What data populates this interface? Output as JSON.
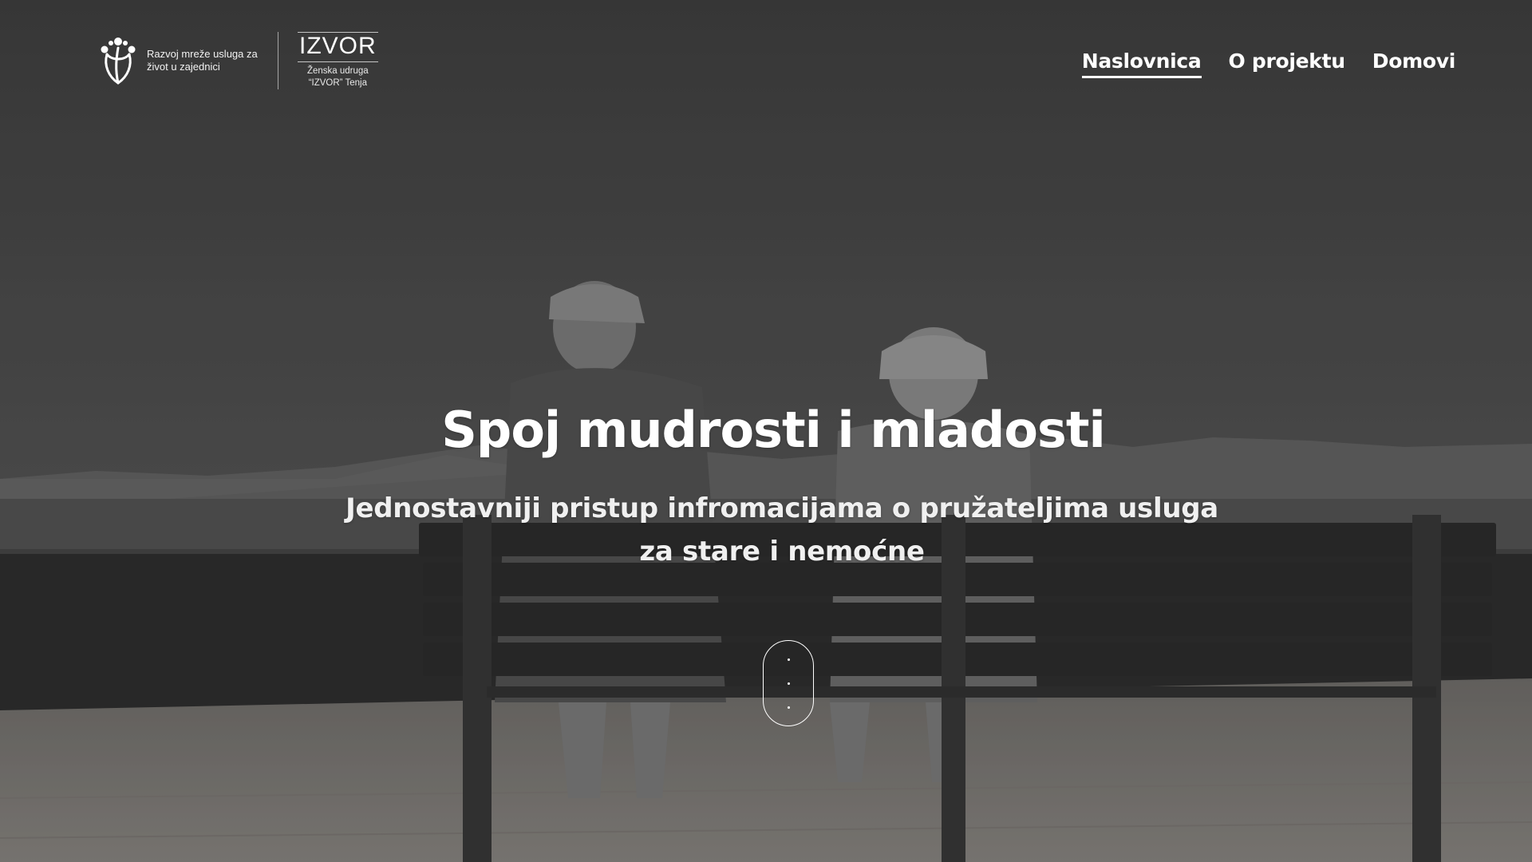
{
  "header": {
    "logo": {
      "icon": "people-tree-logo-icon",
      "text": "Razvoj mreže usluga za život u zajednici"
    },
    "partner_logo": {
      "wordmark": "IZVOR",
      "subtitle_line1": "Ženska udruga",
      "subtitle_line2": "“IZVOR” Tenja"
    },
    "nav": [
      {
        "label": "Naslovnica",
        "active": true
      },
      {
        "label": "O projektu",
        "active": false
      },
      {
        "label": "Domovi",
        "active": false
      }
    ]
  },
  "hero": {
    "title": "Spoj mudrosti i mladosti",
    "subtitle_line1": "Jednostavniji pristup infromacijama o pružateljima usluga",
    "subtitle_line2": "za stare i nemoćne",
    "scroll_indicator_icon": "scroll-down-icon",
    "background": "elderly-couple-on-bench-photo"
  },
  "colors": {
    "text": "#ffffff",
    "sky": "#4a4a4a",
    "ground": "#8a8580"
  }
}
